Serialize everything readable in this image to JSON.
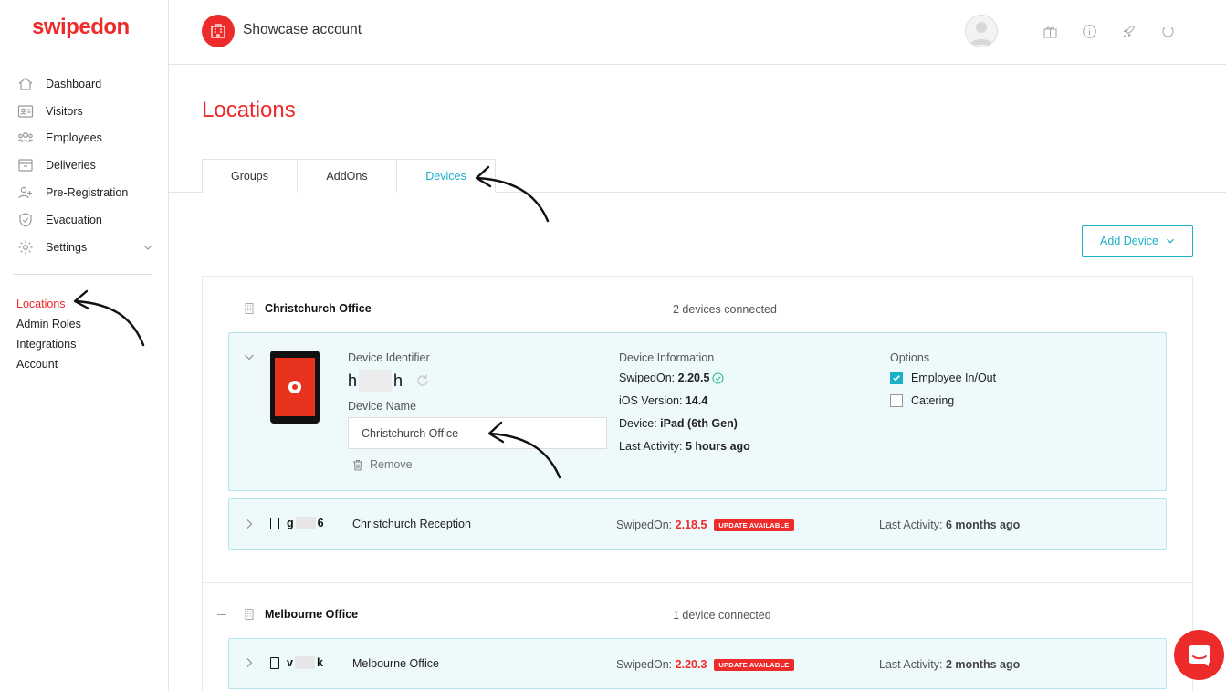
{
  "app": {
    "logo": "swipedon",
    "org_name": "Showcase account"
  },
  "sidebar": {
    "items": [
      {
        "label": "Dashboard",
        "icon": "home-icon"
      },
      {
        "label": "Visitors",
        "icon": "id-card-icon"
      },
      {
        "label": "Employees",
        "icon": "people-icon"
      },
      {
        "label": "Deliveries",
        "icon": "box-icon"
      },
      {
        "label": "Pre-Registration",
        "icon": "user-plus-icon"
      },
      {
        "label": "Evacuation",
        "icon": "shield-icon"
      },
      {
        "label": "Settings",
        "icon": "gear-icon"
      }
    ],
    "sub_items": [
      "Locations",
      "Admin Roles",
      "Integrations",
      "Account"
    ]
  },
  "header": {
    "icons": [
      "avatar",
      "gift-icon",
      "info-icon",
      "rocket-icon",
      "power-icon"
    ]
  },
  "page": {
    "title": "Locations",
    "tabs": [
      "Groups",
      "AddOns",
      "Devices"
    ],
    "active_tab": "Devices",
    "add_device_label": "Add Device"
  },
  "groups": [
    {
      "name": "Christchurch Office",
      "count": "2 devices connected",
      "expanded_device": {
        "identifier_label": "Device Identifier",
        "identifier_start": "h",
        "identifier_end": "h",
        "name_label": "Device Name",
        "name_value": "Christchurch Office",
        "remove_label": "Remove",
        "info_label": "Device Information",
        "swipedon_label": "SwipedOn:",
        "swipedon_value": "2.20.5",
        "ios_label": "iOS Version:",
        "ios_value": "14.4",
        "device_label": "Device:",
        "device_value": "iPad (6th Gen)",
        "activity_label": "Last Activity:",
        "activity_value": "5 hours ago",
        "options_label": "Options",
        "options": [
          {
            "label": "Employee In/Out",
            "checked": true
          },
          {
            "label": "Catering",
            "checked": false
          }
        ]
      },
      "devices": [
        {
          "id_start": "g",
          "id_end": "6",
          "name": "Christchurch Reception",
          "swipedon_label": "SwipedOn:",
          "version": "2.18.5",
          "badge": "UPDATE AVAILABLE",
          "activity_label": "Last Activity:",
          "activity": "6 months ago"
        }
      ]
    },
    {
      "name": "Melbourne Office",
      "count": "1 device connected",
      "devices": [
        {
          "id_start": "v",
          "id_end": "k",
          "name": "Melbourne Office",
          "swipedon_label": "SwipedOn:",
          "version": "2.20.3",
          "badge": "UPDATE AVAILABLE",
          "activity_label": "Last Activity:",
          "activity": "2 months ago"
        }
      ]
    }
  ],
  "colors": {
    "brand": "#ee2b2b",
    "accent": "#1ab0c7",
    "device_bg": "#eef9fb"
  }
}
